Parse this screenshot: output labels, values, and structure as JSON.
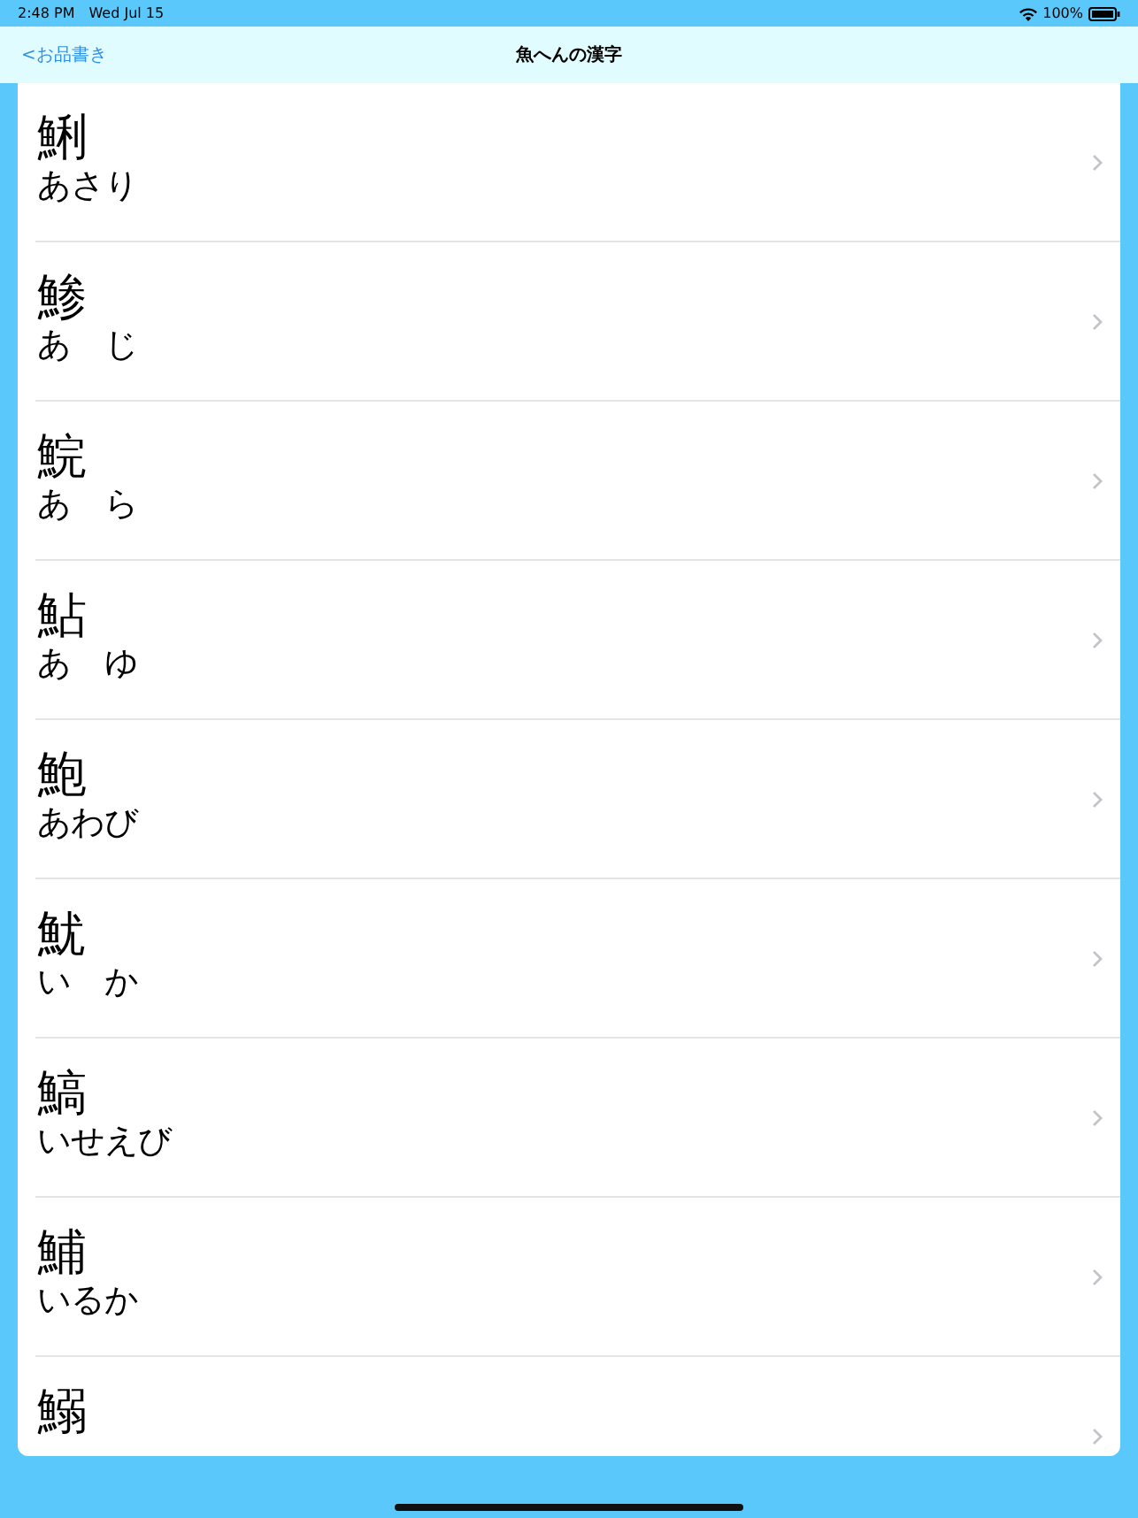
{
  "status_bar": {
    "time": "2:48 PM",
    "date": "Wed Jul 15",
    "battery": "100%"
  },
  "nav_bar": {
    "back": "<お品書き",
    "title": "魚へんの漢字"
  },
  "items": [
    {
      "kanji": "鯏",
      "reading": "あさり"
    },
    {
      "kanji": "鯵",
      "reading": "あ　じ"
    },
    {
      "kanji": "鯇",
      "reading": "あ　ら"
    },
    {
      "kanji": "鮎",
      "reading": "あ　ゆ"
    },
    {
      "kanji": "鮑",
      "reading": "あわび"
    },
    {
      "kanji": "魷",
      "reading": "い　か"
    },
    {
      "kanji": "鰝",
      "reading": "いせえび"
    },
    {
      "kanji": "鯆",
      "reading": "いるか"
    },
    {
      "kanji": "鰯"
    }
  ]
}
